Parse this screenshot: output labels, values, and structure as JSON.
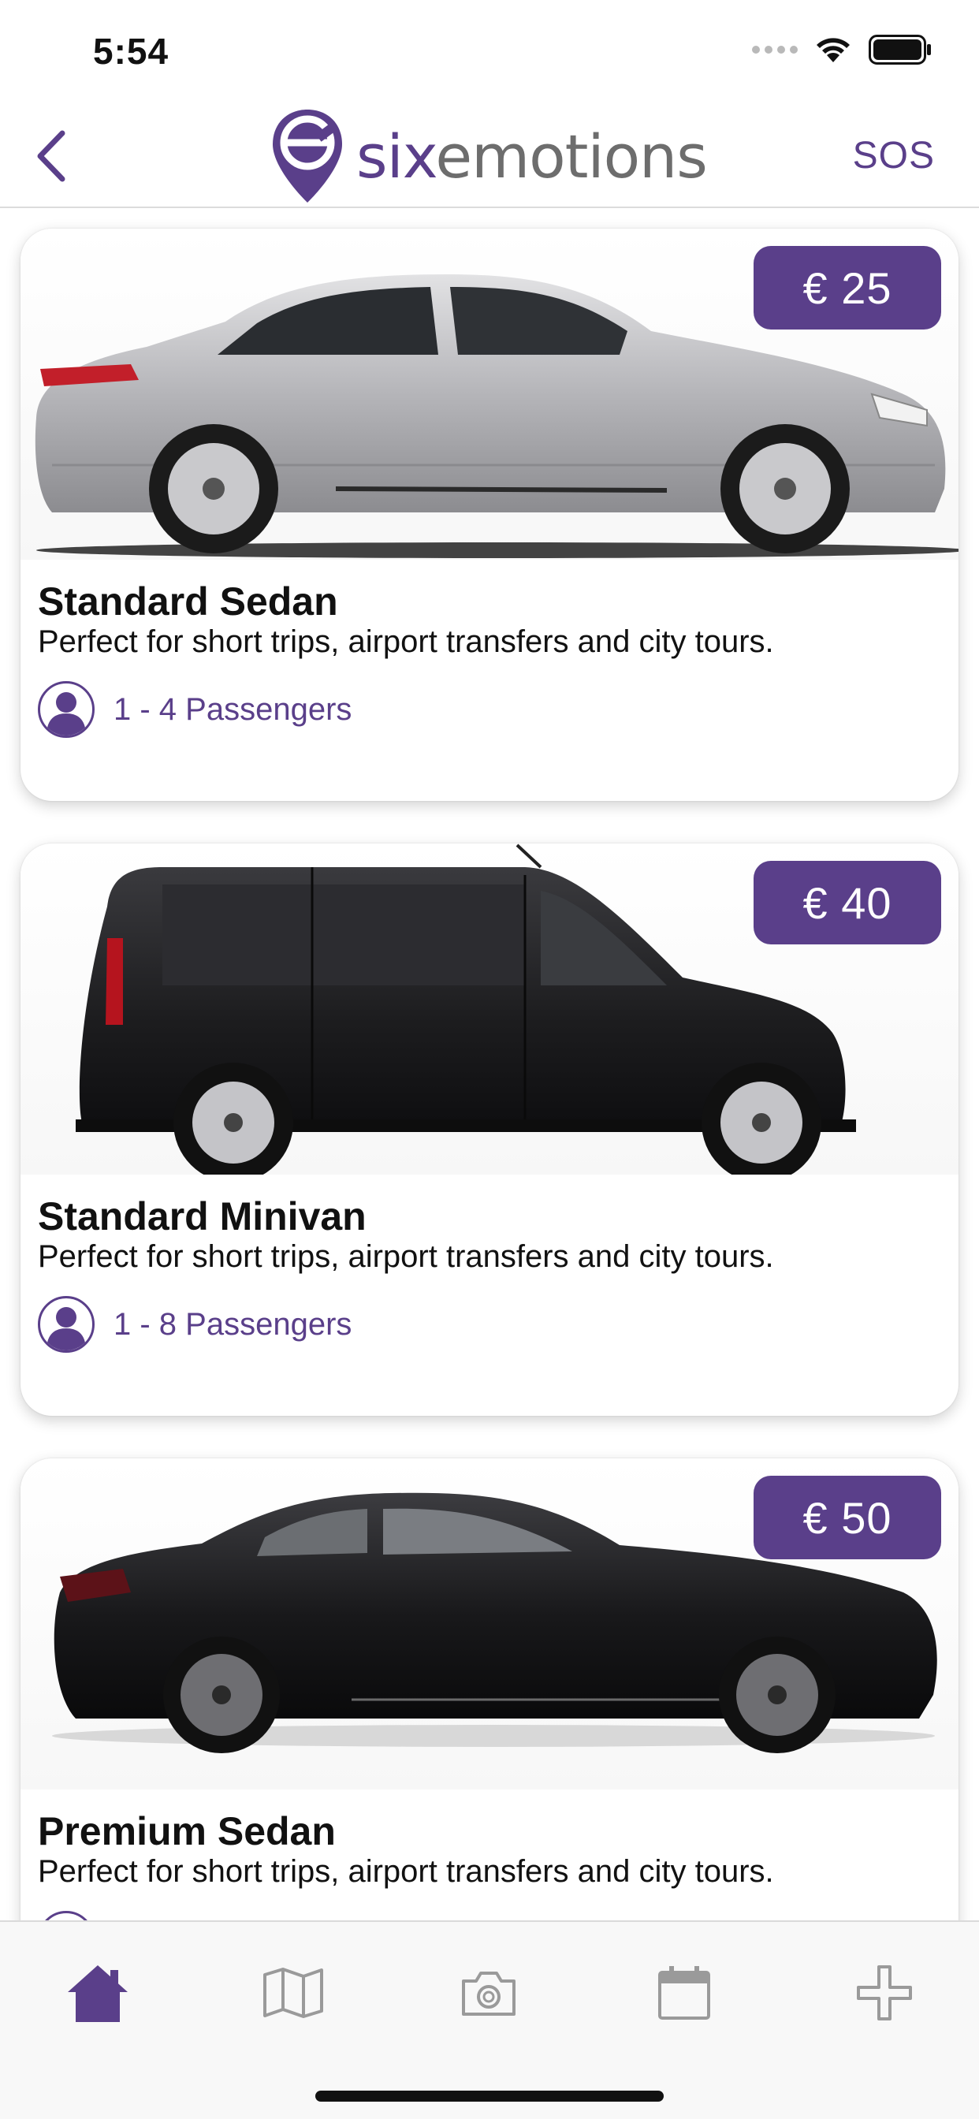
{
  "status_bar": {
    "time": "5:54"
  },
  "nav": {
    "brand_prefix": "six",
    "brand_suffix": "emotions",
    "sos_label": "SOS"
  },
  "vehicles": [
    {
      "title": "Standard Sedan",
      "description": "Perfect for short trips, airport transfers and city tours.",
      "price": "€ 25",
      "passengers": "1 - 4 Passengers",
      "color": "#b8b8bc"
    },
    {
      "title": "Standard Minivan",
      "description": "Perfect for short trips, airport transfers and city tours.",
      "price": "€ 40",
      "passengers": "1 - 8 Passengers",
      "color": "#1c1c1e"
    },
    {
      "title": "Premium Sedan",
      "description": "Perfect for short trips, airport transfers and city tours.",
      "price": "€ 50",
      "passengers": "",
      "color": "#141416"
    }
  ],
  "tabs": [
    {
      "icon": "home-icon",
      "active": true
    },
    {
      "icon": "map-icon",
      "active": false
    },
    {
      "icon": "camera-icon",
      "active": false
    },
    {
      "icon": "calendar-icon",
      "active": false
    },
    {
      "icon": "plus-icon",
      "active": false
    }
  ],
  "colors": {
    "accent": "#5a3f8a",
    "inactive_icon": "#9a9a9a",
    "tab_bar_bg": "#f8f8f8"
  }
}
